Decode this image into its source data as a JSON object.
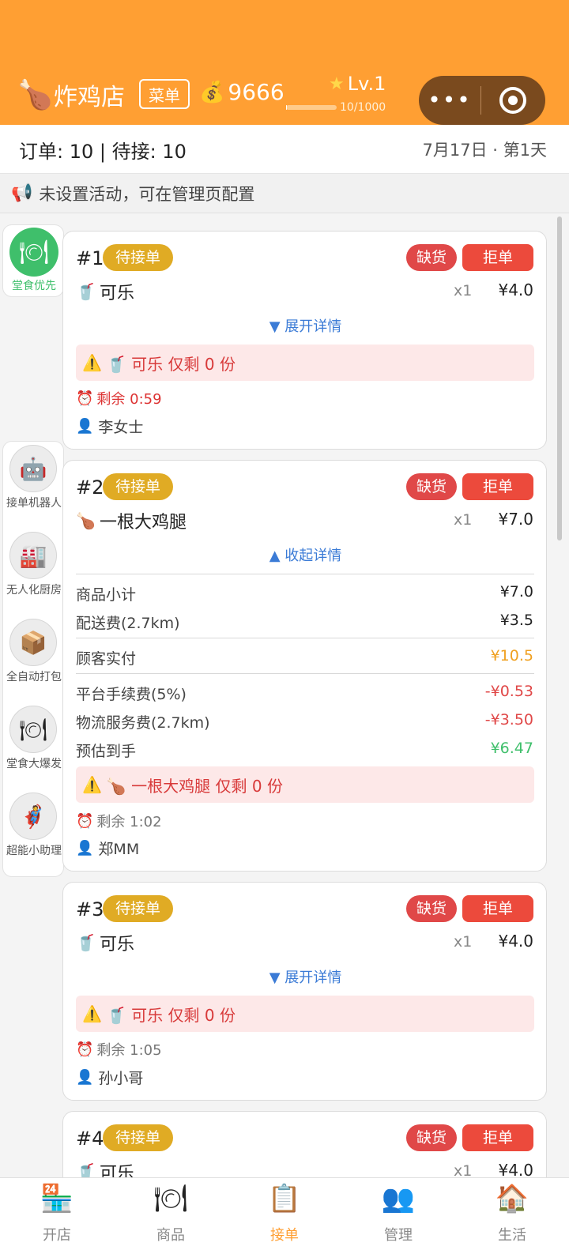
{
  "header": {
    "shop_icon": "🍗",
    "shop_name": "炸鸡店",
    "menu_label": "菜单",
    "coin_icon": "💰",
    "coins": "9666",
    "level": "Lv.1",
    "xp": "10/1000",
    "xp_progress": 0.01,
    "capsule_dots": "•••"
  },
  "stats": {
    "orders_text": "订单: 10 | 待接: 10",
    "date_text": "7月17日 · 第1天"
  },
  "notice": {
    "icon": "📢",
    "text": "未设置活动，可在管理页配置"
  },
  "side": {
    "dine_in_label": "堂食优先",
    "tools": [
      {
        "icon": "🤖",
        "label": "接单机器人"
      },
      {
        "icon": "🏭",
        "label": "无人化厨房"
      },
      {
        "icon": "📦",
        "label": "全自动打包"
      },
      {
        "icon": "🍽",
        "label": "堂食大爆发"
      },
      {
        "icon": "🦸",
        "label": "超能小助理"
      }
    ]
  },
  "orders": [
    {
      "no": "#1",
      "status": "待接单",
      "stock_btn": "缺货",
      "reject_btn": "拒单",
      "item_icon": "🥤",
      "item_name": "可乐",
      "qty": "x1",
      "price": "¥4.0",
      "toggle": "▼ 展开详情",
      "warning": "🥤 可乐 仅剩 0 份",
      "timer": "剩余 0:59",
      "customer": "李女士"
    },
    {
      "no": "#2",
      "status": "待接单",
      "stock_btn": "缺货",
      "reject_btn": "拒单",
      "item_icon": "🍗",
      "item_name": "一根大鸡腿",
      "qty": "x1",
      "price": "¥7.0",
      "toggle": "▲ 收起详情",
      "details": {
        "subtotal_label": "商品小计",
        "subtotal": "¥7.0",
        "delivery_label": "配送费(2.7km)",
        "delivery": "¥3.5",
        "paid_label": "顾客实付",
        "paid": "¥10.5",
        "fee_label": "平台手续费(5%)",
        "fee": "-¥0.53",
        "logistics_label": "物流服务费(2.7km)",
        "logistics": "-¥3.50",
        "net_label": "预估到手",
        "net": "¥6.47"
      },
      "warning": "🍗 一根大鸡腿 仅剩 0 份",
      "timer": "剩余 1:02",
      "customer": "郑MM"
    },
    {
      "no": "#3",
      "status": "待接单",
      "stock_btn": "缺货",
      "reject_btn": "拒单",
      "item_icon": "🥤",
      "item_name": "可乐",
      "qty": "x1",
      "price": "¥4.0",
      "toggle": "▼ 展开详情",
      "warning": "🥤 可乐 仅剩 0 份",
      "timer": "剩余 1:05",
      "customer": "孙小哥"
    },
    {
      "no": "#4",
      "status": "待接单",
      "stock_btn": "缺货",
      "reject_btn": "拒单",
      "item_icon": "🥤",
      "item_name": "可乐",
      "qty": "x1",
      "price": "¥4.0"
    }
  ],
  "tabs": [
    {
      "icon": "🏪",
      "label": "开店"
    },
    {
      "icon": "🍽",
      "label": "商品"
    },
    {
      "icon": "📋",
      "label": "接单"
    },
    {
      "icon": "👥",
      "label": "管理"
    },
    {
      "icon": "🏠",
      "label": "生活"
    }
  ],
  "colors": {
    "brand": "#ff9f33",
    "badge": "#e0ab24",
    "danger": "#ec4a3c",
    "link": "#3b7bd6",
    "paid": "#f0a020",
    "fee": "#e04848",
    "net": "#3fbf6b"
  }
}
